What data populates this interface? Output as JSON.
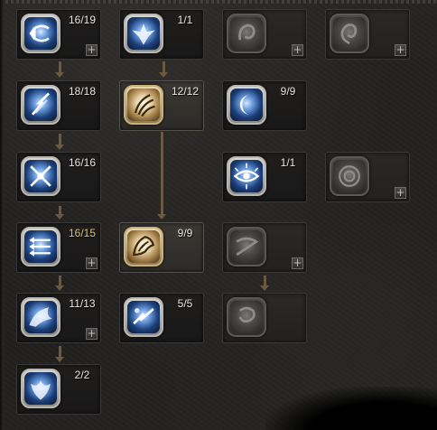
{
  "skill_tree": {
    "rows": [
      [
        {
          "col": 0,
          "level": "16/19",
          "state": "learned",
          "plus": "+",
          "icon": "arrow-return-icon"
        },
        {
          "col": 1,
          "level": "1/1",
          "state": "learned",
          "plus": "",
          "icon": "phoenix-icon"
        },
        {
          "col": 2,
          "level": "",
          "state": "locked",
          "plus": "+",
          "icon": "swirl-icon"
        },
        {
          "col": 3,
          "level": "",
          "state": "locked",
          "plus": "+",
          "icon": "flame-spiral-icon"
        }
      ],
      [
        {
          "col": 0,
          "level": "18/18",
          "state": "learned",
          "plus": "",
          "icon": "lightning-slash-icon"
        },
        {
          "col": 1,
          "level": "12/12",
          "state": "learned-highlight",
          "plus": "",
          "icon": "golden-claw-icon"
        },
        {
          "col": 2,
          "level": "9/9",
          "state": "learned",
          "plus": "",
          "icon": "crescent-moon-icon"
        }
      ],
      [
        {
          "col": 0,
          "level": "16/16",
          "state": "learned",
          "plus": "",
          "icon": "crossed-blades-icon"
        },
        {
          "col": 2,
          "level": "1/1",
          "state": "learned",
          "plus": "",
          "icon": "eye-sigil-icon"
        },
        {
          "col": 3,
          "level": "",
          "state": "locked",
          "plus": "+",
          "icon": "concentric-rings-icon"
        }
      ],
      [
        {
          "col": 0,
          "level": "16/15",
          "state": "learned-over",
          "plus": "+",
          "icon": "triple-arrow-icon"
        },
        {
          "col": 1,
          "level": "9/9",
          "state": "learned-highlight",
          "plus": "",
          "icon": "golden-wing-icon"
        },
        {
          "col": 2,
          "level": "",
          "state": "locked",
          "plus": "+",
          "icon": "whirlwind-icon"
        }
      ],
      [
        {
          "col": 0,
          "level": "11/13",
          "state": "learned",
          "plus": "+",
          "icon": "bird-wing-icon"
        },
        {
          "col": 1,
          "level": "5/5",
          "state": "learned",
          "plus": "",
          "icon": "dash-strike-icon"
        },
        {
          "col": 2,
          "level": "",
          "state": "locked",
          "plus": "",
          "icon": "storm-icon"
        }
      ],
      [
        {
          "col": 0,
          "level": "2/2",
          "state": "learned",
          "plus": "",
          "icon": "phoenix-rise-icon"
        }
      ]
    ]
  }
}
